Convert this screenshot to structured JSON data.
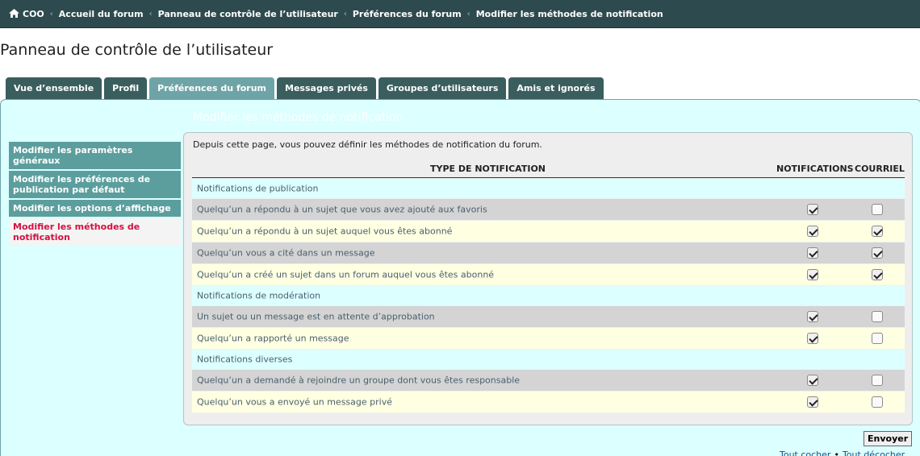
{
  "breadcrumb": {
    "items": [
      {
        "label": "COO",
        "icon": "home-icon"
      },
      {
        "label": "Accueil du forum"
      },
      {
        "label": "Panneau de contrôle de l’utilisateur"
      },
      {
        "label": "Préférences du forum"
      },
      {
        "label": "Modifier les méthodes de notification"
      }
    ],
    "separator": "‹"
  },
  "page_title": "Panneau de contrôle de l’utilisateur",
  "tabs": [
    {
      "label": "Vue d’ensemble"
    },
    {
      "label": "Profil"
    },
    {
      "label": "Préférences du forum",
      "active": true
    },
    {
      "label": "Messages privés"
    },
    {
      "label": "Groupes d’utilisateurs"
    },
    {
      "label": "Amis et ignorés"
    }
  ],
  "menu": [
    {
      "label": "Modifier les paramètres généraux"
    },
    {
      "label": "Modifier les préférences de publication par défaut"
    },
    {
      "label": "Modifier les options d’affichage"
    },
    {
      "label": "Modifier les méthodes de notification",
      "current": true
    }
  ],
  "section_heading": "Modifier les méthodes de notification",
  "intro": "Depuis cette page, vous pouvez définir les méthodes de notification du forum.",
  "table": {
    "headers": {
      "type": "TYPE DE NOTIFICATION",
      "notifications": "NOTIFICATIONS",
      "mail": "COURRIEL"
    },
    "rows": [
      {
        "kind": "group",
        "label": "Notifications de publication"
      },
      {
        "kind": "item",
        "label": "Quelqu’un a répondu à un sujet que vous avez ajouté aux favoris",
        "notif": true,
        "mail": false
      },
      {
        "kind": "item",
        "label": "Quelqu’un a répondu à un sujet auquel vous êtes abonné",
        "notif": true,
        "mail": true
      },
      {
        "kind": "item",
        "label": "Quelqu’un vous a cité dans un message",
        "notif": true,
        "mail": true
      },
      {
        "kind": "item",
        "label": "Quelqu’un a créé un sujet dans un forum auquel vous êtes abonné",
        "notif": true,
        "mail": true
      },
      {
        "kind": "group",
        "label": "Notifications de modération"
      },
      {
        "kind": "item",
        "label": "Un sujet ou un message est en attente d’approbation",
        "notif": true,
        "mail": false
      },
      {
        "kind": "item",
        "label": "Quelqu’un a rapporté un message",
        "notif": true,
        "mail": false
      },
      {
        "kind": "group",
        "label": "Notifications diverses"
      },
      {
        "kind": "item",
        "label": "Quelqu’un a demandé à rejoindre un groupe dont vous êtes responsable",
        "notif": true,
        "mail": false
      },
      {
        "kind": "item",
        "label": "Quelqu’un vous a envoyé un message privé",
        "notif": true,
        "mail": false
      }
    ]
  },
  "submit_label": "Envoyer",
  "mark_all": "Tout cocher",
  "unmark_all": "Tout décocher",
  "colors": {
    "topbar": "#2d4a4e",
    "tab": "#3a5e5d",
    "tab_active": "#6ea4a8",
    "panel_bg": "#dcffff",
    "menu_item": "#5b9e9d",
    "menu_current_text": "#d31141",
    "row_alt1": "#d4d4d4",
    "row_alt2": "#ffffe2"
  }
}
